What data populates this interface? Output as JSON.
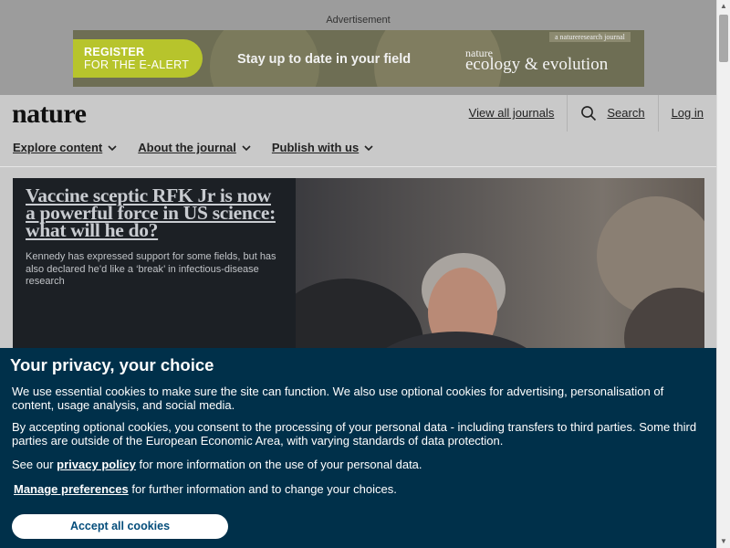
{
  "advertisement": {
    "label": "Advertisement",
    "register_line1": "REGISTER",
    "register_line2": "FOR THE E-ALERT",
    "tagline": "Stay up to date in your field",
    "network_tag": "a natureresearch journal",
    "brand_small": "nature",
    "journal_name": "ecology & evolution"
  },
  "header": {
    "logo": "nature",
    "view_all_journals": "View all journals",
    "search": "Search",
    "login": "Log in",
    "nav": [
      "Explore content",
      "About the journal",
      "Publish with us"
    ]
  },
  "hero": {
    "title": "Vaccine sceptic RFK Jr is now a powerful force in US science: what will he do?",
    "summary": "Kennedy has expressed support for some fields, but has also declared he’d like a ‘break’ in infectious-disease research"
  },
  "cookie_banner": {
    "title": "Your privacy, your choice",
    "paragraph1": "We use essential cookies to make sure the site can function. We also use optional cookies for advertising, personalisation of content, usage analysis, and social media.",
    "paragraph2": "By accepting optional cookies, you consent to the processing of your personal data - including transfers to third parties. Some third parties are outside of the European Economic Area, with varying standards of data protection.",
    "see_our": "See our",
    "privacy_policy": "privacy policy",
    "privacy_rest": "for more information on the use of your personal data.",
    "manage_preferences": "Manage preferences",
    "manage_rest": "for further information and to change your choices.",
    "accept_all": "Accept all cookies"
  },
  "colors": {
    "cookie_bg": "#00304a",
    "ad_register": "#b7c42c",
    "hero_text_bg": "#1c2025"
  }
}
